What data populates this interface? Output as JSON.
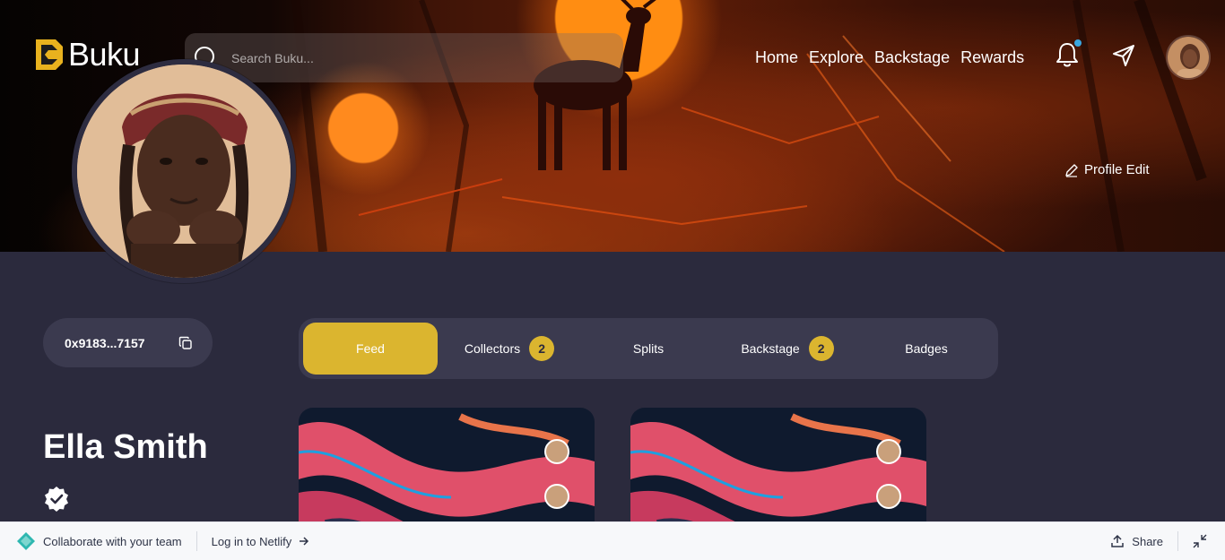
{
  "app": {
    "brand": "Buku",
    "accent": "#dbb52f",
    "background": "#2b2a3d"
  },
  "header": {
    "search_placeholder": "Search Buku...",
    "nav": [
      "Home",
      "Explore",
      "Backstage",
      "Rewards"
    ],
    "has_notification": true
  },
  "profile": {
    "edit_label": "Profile Edit",
    "wallet": "0x9183...7157",
    "name": "Ella Smith",
    "verified": true
  },
  "tabs": [
    {
      "label": "Feed",
      "active": true,
      "count": null
    },
    {
      "label": "Collectors",
      "active": false,
      "count": "2"
    },
    {
      "label": "Splits",
      "active": false,
      "count": null
    },
    {
      "label": "Backstage",
      "active": false,
      "count": "2"
    },
    {
      "label": "Badges",
      "active": false,
      "count": null
    }
  ],
  "netlify": {
    "collaborate": "Collaborate with your team",
    "login": "Log in to Netlify",
    "share": "Share"
  },
  "icons": [
    "buku-logo-icon",
    "search-icon",
    "bell-icon",
    "send-icon",
    "pencil-icon",
    "copy-icon",
    "verified-icon",
    "netlify-icon",
    "arrow-right-icon",
    "share-icon",
    "collapse-icon"
  ]
}
